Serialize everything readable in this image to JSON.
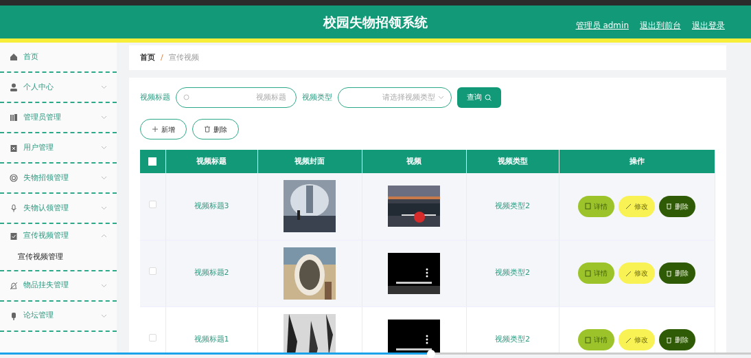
{
  "header": {
    "title": "校园失物招领系统",
    "links": [
      "管理员 admin",
      "退出到前台",
      "退出登录"
    ]
  },
  "sidebar": {
    "items": [
      {
        "label": "首页"
      },
      {
        "label": "个人中心",
        "expanded": false
      },
      {
        "label": "管理员管理",
        "expanded": false
      },
      {
        "label": "用户管理",
        "expanded": false
      },
      {
        "label": "失物招领管理",
        "expanded": false
      },
      {
        "label": "失物认领管理",
        "expanded": false
      },
      {
        "label": "宣传视频管理",
        "expanded": true,
        "children": [
          {
            "label": "宣传视频管理"
          }
        ]
      },
      {
        "label": "物品挂失管理",
        "expanded": false
      },
      {
        "label": "论坛管理",
        "expanded": false
      }
    ]
  },
  "breadcrumb": {
    "items": [
      "首页",
      "宣传视频"
    ],
    "separator": "/"
  },
  "search": {
    "fields": [
      {
        "label": "视频标题",
        "placeholder": "视频标题",
        "kind": "text"
      },
      {
        "label": "视频类型",
        "placeholder": "请选择视频类型",
        "kind": "select"
      }
    ],
    "button": "查询"
  },
  "toolbar": [
    "新增",
    "删除"
  ],
  "table": {
    "select_all_checked": false,
    "columns": [
      "视频标题",
      "视频封面",
      "视频",
      "视频类型",
      "操作"
    ],
    "rows": [
      {
        "checked": false,
        "title": "视频标题3",
        "type": "视频类型2",
        "actions": [
          "详情",
          "修改",
          "删除"
        ]
      },
      {
        "checked": false,
        "title": "视频标题2",
        "type": "视频类型2",
        "actions": [
          "详情",
          "修改",
          "删除"
        ]
      },
      {
        "checked": false,
        "title": "视频标题1",
        "type": "视频类型2",
        "actions": [
          "详情",
          "修改",
          "删除"
        ]
      }
    ]
  },
  "player": {
    "progress": {
      "level": 0.574
    }
  }
}
